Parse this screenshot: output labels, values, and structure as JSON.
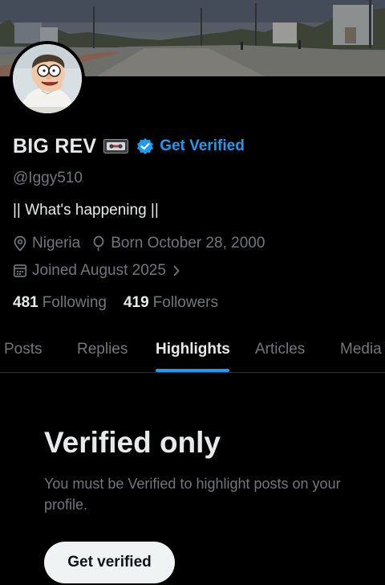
{
  "profile": {
    "display_name": "BIG REV",
    "get_verified_label": "Get Verified",
    "handle": "@Iggy510",
    "bio": "|| What's happening ||",
    "location": "Nigeria",
    "birthday": "Born October 28, 2000",
    "joined": "Joined August 2025",
    "following_count": "481",
    "following_label": "Following",
    "followers_count": "419",
    "followers_label": "Followers"
  },
  "tabs": [
    {
      "label": "Posts"
    },
    {
      "label": "Replies"
    },
    {
      "label": "Highlights",
      "active": true
    },
    {
      "label": "Articles"
    },
    {
      "label": "Media"
    }
  ],
  "empty_state": {
    "title": "Verified only",
    "text": "You must be Verified to highlight posts on your profile.",
    "button_label": "Get verified"
  },
  "icons": {
    "tape": "videocassette-icon",
    "verified": "verified-badge-icon",
    "location": "location-pin-icon",
    "birthday": "balloon-icon",
    "calendar": "calendar-icon",
    "chevron": "chevron-right-icon"
  },
  "colors": {
    "background": "#000000",
    "accent": "#1d9bf0",
    "primary_text": "#e7e9ea",
    "secondary_text": "#71767b",
    "divider": "#2f3336"
  }
}
